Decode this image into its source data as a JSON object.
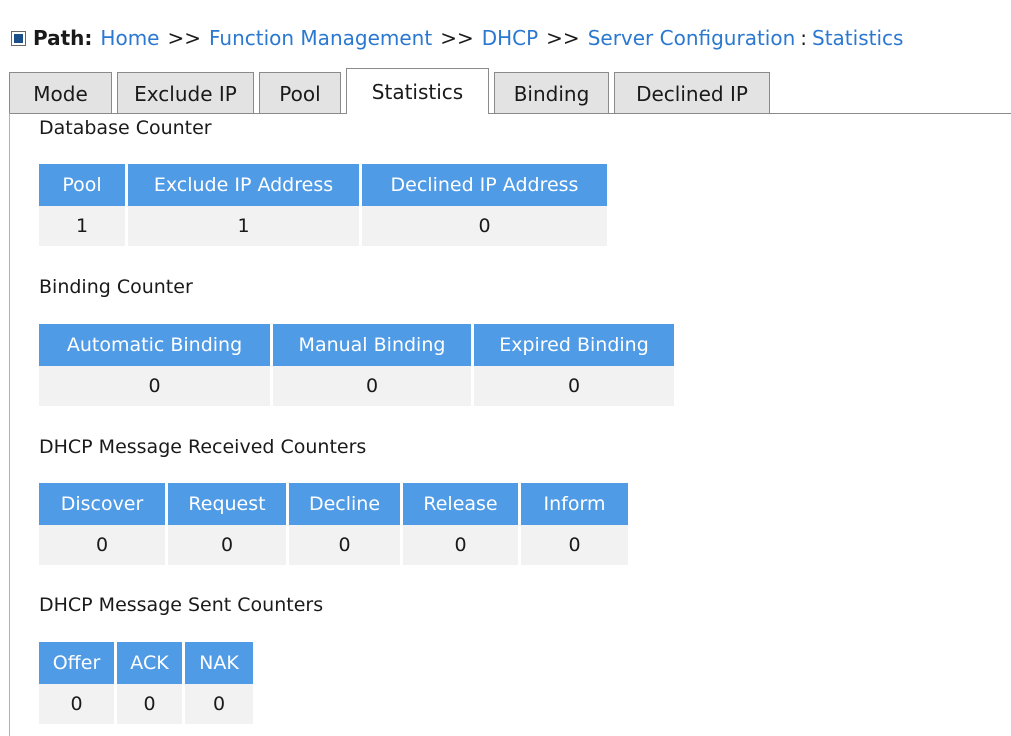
{
  "path": {
    "label": "Path:",
    "crumbs": [
      "Home",
      "Function Management",
      "DHCP",
      "Server Configuration"
    ],
    "separator": ">>",
    "current": "Statistics"
  },
  "tabs": [
    {
      "label": "Mode",
      "active": false
    },
    {
      "label": "Exclude IP",
      "active": false
    },
    {
      "label": "Pool",
      "active": false
    },
    {
      "label": "Statistics",
      "active": true
    },
    {
      "label": "Binding",
      "active": false
    },
    {
      "label": "Declined IP",
      "active": false
    }
  ],
  "database_counter": {
    "title": "Database Counter",
    "headers": [
      "Pool",
      "Exclude IP Address",
      "Declined IP Address"
    ],
    "values": [
      "1",
      "1",
      "0"
    ]
  },
  "binding_counter": {
    "title": "Binding Counter",
    "headers": [
      "Automatic Binding",
      "Manual Binding",
      "Expired Binding"
    ],
    "values": [
      "0",
      "0",
      "0"
    ]
  },
  "received_counters": {
    "title": "DHCP Message Received Counters",
    "headers": [
      "Discover",
      "Request",
      "Decline",
      "Release",
      "Inform"
    ],
    "values": [
      "0",
      "0",
      "0",
      "0",
      "0"
    ]
  },
  "sent_counters": {
    "title": "DHCP Message Sent Counters",
    "headers": [
      "Offer",
      "ACK",
      "NAK"
    ],
    "values": [
      "0",
      "0",
      "0"
    ]
  },
  "colors": {
    "link": "#2b78d0",
    "header_bg": "#4f9be6",
    "cell_bg": "#f2f2f2",
    "tab_bg": "#e3e3e3"
  }
}
